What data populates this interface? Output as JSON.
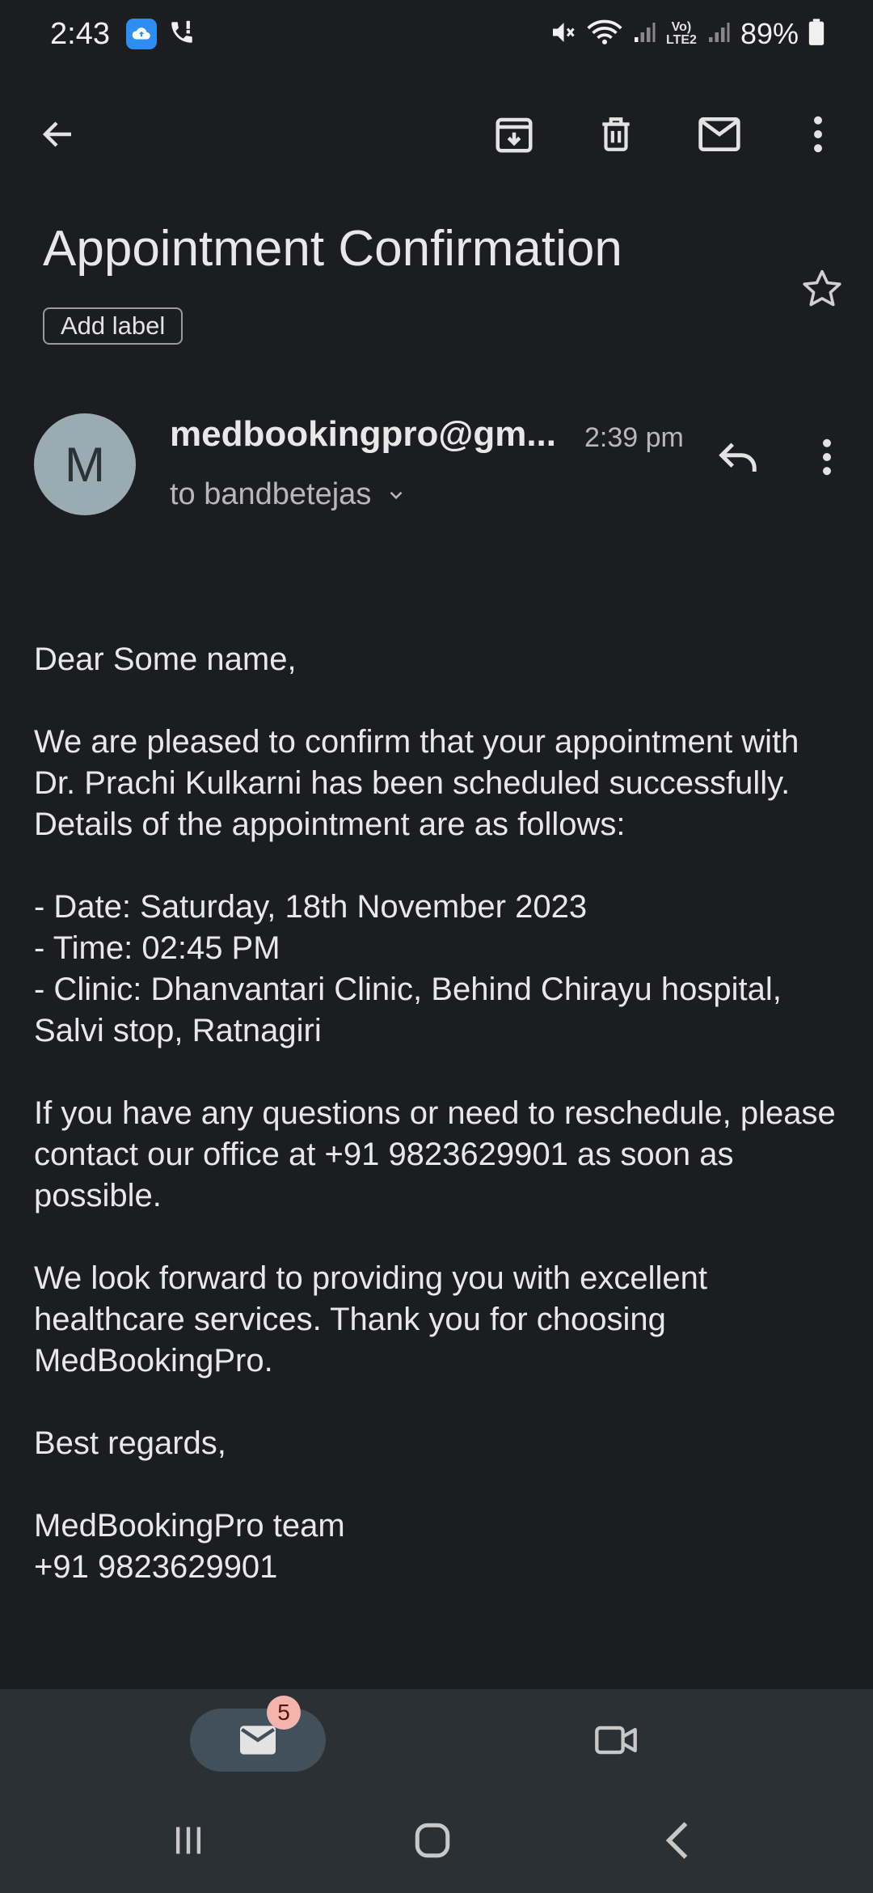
{
  "status_bar": {
    "time": "2:43",
    "battery": "89%",
    "volte_line1": "Vo)",
    "volte_line2": "LTE2"
  },
  "toolbar": {
    "back_icon": "arrow-left-icon",
    "archive_icon": "archive-icon",
    "delete_icon": "trash-icon",
    "mark_unread_icon": "mail-icon",
    "more_icon": "more-vertical-icon"
  },
  "email": {
    "subject": "Appointment Confirmation",
    "add_label": "Add label",
    "sender": "medbookingpro@gm...",
    "avatar_letter": "M",
    "time": "2:39 pm",
    "recipient": "to bandbetejas",
    "body": {
      "greeting": "Dear Some name,",
      "para1": "We are pleased to confirm that your appointment with Dr. Prachi Kulkarni has been scheduled successfully. Details of the appointment are as follows:",
      "date_line": "- Date: Saturday, 18th November 2023",
      "time_line": "- Time: 02:45 PM",
      "clinic_line": "- Clinic: Dhanvantari Clinic, Behind Chirayu hospital, Salvi stop, Ratnagiri",
      "para2": "If you have any questions or need to reschedule, please contact our office at +91 9823629901 as soon as possible.",
      "para3": "We look forward to providing you with excellent healthcare services. Thank you for choosing MedBookingPro.",
      "closing": "Best regards,",
      "signature_name": "MedBookingPro team",
      "signature_phone": "+91 9823629901"
    }
  },
  "bottom_nav": {
    "mail_badge": "5"
  },
  "colors": {
    "background": "#1c1d21",
    "nav_background": "#2b3035",
    "avatar": "#9aabb1",
    "badge": "#f4b4ae",
    "pill": "#42505b"
  }
}
